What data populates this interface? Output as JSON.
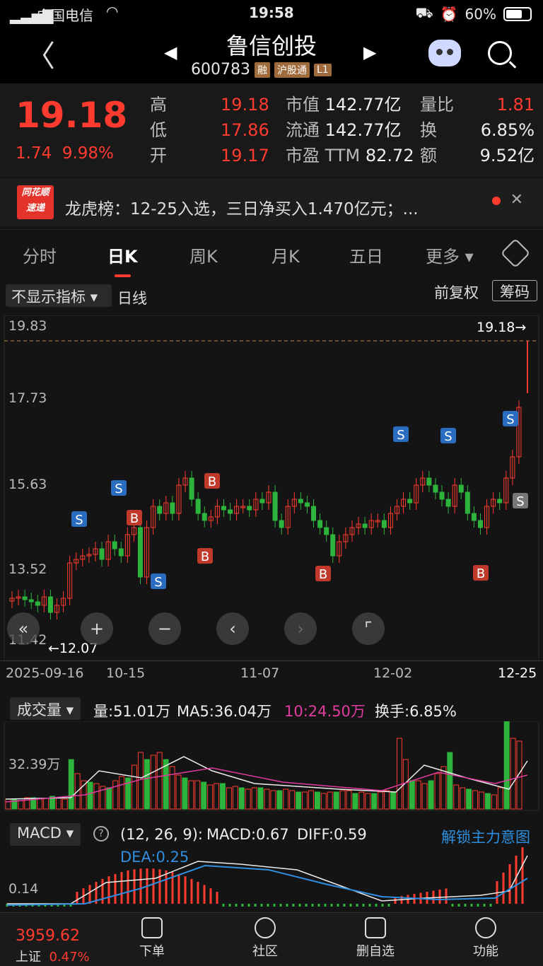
{
  "status": {
    "carrier": "中国电信",
    "time": "19:58",
    "battery": "60%"
  },
  "nav": {
    "title": "鲁信创投",
    "code": "600783",
    "tags": [
      "融",
      "沪股通",
      "L1"
    ]
  },
  "quote": {
    "price": "19.18",
    "change": "1.74",
    "change_pct": "9.98%",
    "rows": [
      {
        "l1": "高",
        "v1": "19.18",
        "l2": "市值",
        "v2": "142.77亿",
        "l3": "量比",
        "v3": "1.81"
      },
      {
        "l1": "低",
        "v1": "17.86",
        "l2": "流通",
        "v2": "142.77亿",
        "l3": "换",
        "v3": "6.85%"
      },
      {
        "l1": "开",
        "v1": "19.17",
        "l2": "市盈 TTM",
        "v2": "82.72",
        "l3": "额",
        "v3": "9.52亿"
      }
    ]
  },
  "banner": {
    "logo_top": "同花顺",
    "logo_bottom": "速递",
    "text": "龙虎榜：12-25入选，三日净买入1.470亿元；..."
  },
  "tabs": [
    "分时",
    "日K",
    "周K",
    "月K",
    "五日",
    "更多"
  ],
  "kline": {
    "indicator": "不显示指标",
    "period": "日线",
    "adjust": "前复权",
    "chips": "筹码",
    "y_labels": [
      "19.83",
      "17.73",
      "15.63",
      "13.52",
      "11.42"
    ],
    "high_mark": "19.18→",
    "low_mark": "←12.07",
    "x_labels": [
      "2025-09-16",
      "10-15",
      "11-07",
      "12-02",
      "12-25"
    ]
  },
  "volume": {
    "selector": "成交量",
    "vol": "量:51.01万",
    "ma5": "MA5:36.04万",
    "ma10": "10:24.50万",
    "turnover": "换手:6.85%",
    "y_label": "32.39万"
  },
  "macd": {
    "selector": "MACD",
    "params": "(12, 26, 9):",
    "macd": "MACD:0.67",
    "diff": "DIFF:0.59",
    "dea": "DEA:0.25",
    "unlock": "解锁主力意图",
    "y_label": "0.14"
  },
  "bottom": {
    "index_value": "3959.62",
    "index_name": "上证",
    "index_pct": "0.47%",
    "items": [
      "下单",
      "社区",
      "删自选",
      "功能"
    ]
  },
  "chart_data": {
    "type": "candlestick",
    "y_range": [
      11.42,
      19.83
    ],
    "close_last": 19.18,
    "markers": [
      {
        "label": "S"
      },
      {
        "label": "S"
      },
      {
        "label": "B"
      },
      {
        "label": "S"
      },
      {
        "label": "B"
      },
      {
        "label": "B"
      },
      {
        "label": "B"
      },
      {
        "label": "S"
      },
      {
        "label": "S"
      },
      {
        "label": "B"
      },
      {
        "label": "S"
      },
      {
        "label": "S"
      }
    ]
  }
}
